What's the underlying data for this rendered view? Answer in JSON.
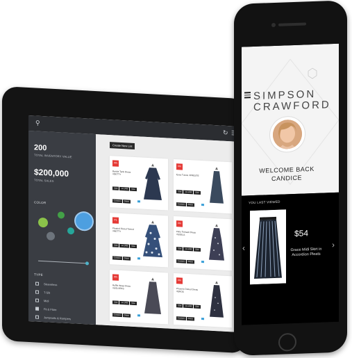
{
  "tablet": {
    "sidebar": {
      "inventory_value": "200",
      "inventory_label": "TOTAL INVENTORY VALUE",
      "sales_value": "$200,000",
      "sales_label": "TOTAL SALES",
      "color_label": "COLOR",
      "type_label": "TYPE",
      "types": [
        "Sleeveless",
        "T-Slit",
        "Midi",
        "Fit & Flare",
        "Jumpsuits & Rompers"
      ],
      "colors": [
        "#8bc34a",
        "#43a047",
        "#6d747c",
        "#26a69a",
        "#4d9fe0"
      ]
    },
    "main": {
      "new_list_button": "Create New List",
      "cards": [
        {
          "badge": "PR",
          "name": "Bardot Tank Dress #DETTY",
          "sizes": [
            "Size",
            "14-14W",
            "Size",
            "Custom",
            "Dress"
          ],
          "avail": "Availability"
        },
        {
          "badge": "PR",
          "name": "Eyes Tuxxie #PRESTE",
          "sizes": [
            "Size",
            "14-14W",
            "Size",
            "Custom",
            "Dress"
          ],
          "avail": "Availability"
        },
        {
          "badge": "P1",
          "name": "Pleated Fluted Tweed #NETTY",
          "sizes": [
            "Size",
            "14-14W",
            "Size",
            "Custom",
            "Dress"
          ],
          "avail": "Availability"
        },
        {
          "badge": "PR",
          "name": "Flirty Tieback Dress #SOELS",
          "sizes": [
            "Size",
            "14-14W",
            "Size",
            "Custom",
            "Dress"
          ],
          "avail": "Availability"
        },
        {
          "badge": "PR",
          "name": "Ruffle Wrap Dress #SOLVERS",
          "sizes": [
            "Size",
            "14-14W",
            "Size",
            "Custom",
            "Dress"
          ],
          "avail": "Availability"
        },
        {
          "badge": "PR",
          "name": "Phoenix Dotted Dress #EROS",
          "sizes": [
            "Size",
            "14-14W",
            "Size",
            "Custom",
            "Dress"
          ],
          "avail": "Availability"
        }
      ]
    }
  },
  "phone": {
    "brand_line1": "SIMPSON",
    "brand_line2": "CRAWFORD",
    "welcome_line1": "WELCOME BACK",
    "welcome_line2": "CANDICE",
    "last_viewed_label": "YOU LAST VIEWED",
    "product": {
      "price": "$54",
      "name_line1": "Grace Midi Skirt in",
      "name_line2": "Accordion Pleats"
    }
  }
}
